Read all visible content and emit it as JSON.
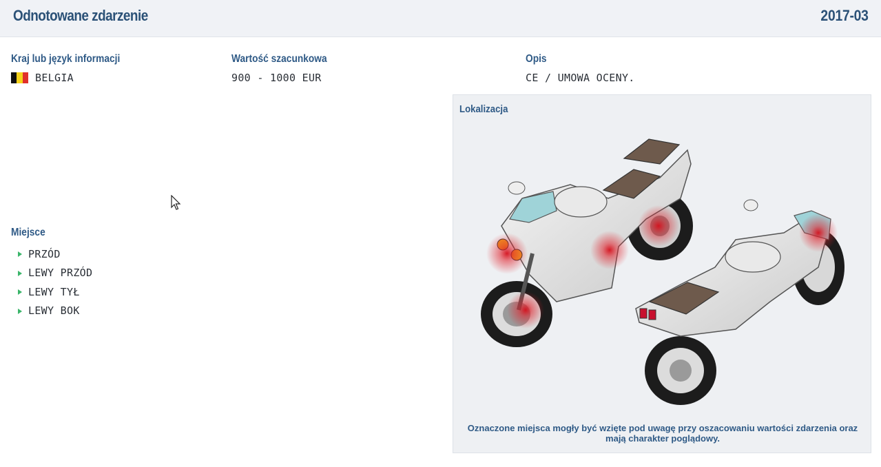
{
  "header": {
    "title": "Odnotowane zdarzenie",
    "date": "2017-03"
  },
  "country": {
    "label": "Kraj lub język informacji",
    "value": "BELGIA",
    "flag_colors": [
      "#111111",
      "#f5d21b",
      "#e0302b"
    ]
  },
  "estimate": {
    "label": "Wartość szacunkowa",
    "value": "900 - 1000 EUR"
  },
  "description": {
    "label": "Opis",
    "value": "CE / UMOWA OCENY."
  },
  "place": {
    "label": "Miejsce",
    "items": [
      "PRZÓD",
      "LEWY PRZÓD",
      "LEWY TYŁ",
      "LEWY BOK"
    ]
  },
  "location": {
    "label": "Lokalizacja",
    "note": "Oznaczone miejsca mogły być wzięte pod uwagę przy oszacowaniu wartości zdarzenia oraz mają charakter poglądowy."
  },
  "colors": {
    "accent": "#2f5a86",
    "bullet": "#3bb56a",
    "damage_marker": "#e0202a"
  }
}
